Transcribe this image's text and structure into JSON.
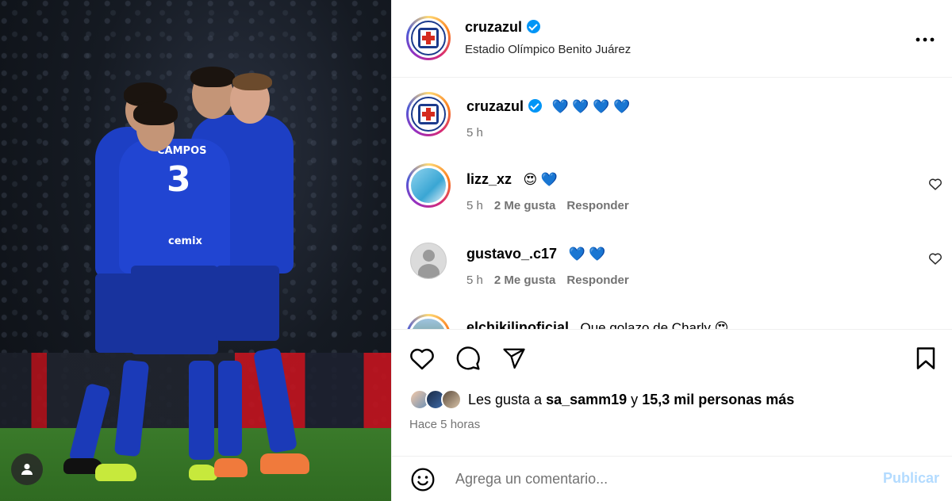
{
  "post": {
    "author": "cruzazul",
    "location": "Estadio Olímpico Benito Juárez",
    "caption_emojis": "💙 💙 💙 💙",
    "caption_time": "5 h",
    "more_icon": "more-options-icon"
  },
  "comments": [
    {
      "user": "lizz_xz",
      "text": "😍 💙",
      "time": "5 h",
      "likes": "2 Me gusta",
      "reply": "Responder"
    },
    {
      "user": "gustavo_.c17",
      "text": "💙 💙",
      "time": "5 h",
      "likes": "2 Me gusta",
      "reply": "Responder"
    },
    {
      "user": "elchikilinoficial",
      "text": "Que golazo de Charly 😍"
    }
  ],
  "likes": {
    "prefix": "Les gusta a ",
    "user": "sa_samm19",
    "middle": " y ",
    "count": "15,3 mil personas más"
  },
  "post_time": "Hace 5 horas",
  "composer": {
    "placeholder": "Agrega un comentario...",
    "publish": "Publicar"
  },
  "jersey": {
    "name": "CAMPOS",
    "number": "3",
    "sponsor": "cemix"
  },
  "colors": {
    "accent": "#0095f6",
    "publish_disabled": "#b3dbff",
    "meta": "#737373",
    "team_blue": "#1d3fc4"
  }
}
